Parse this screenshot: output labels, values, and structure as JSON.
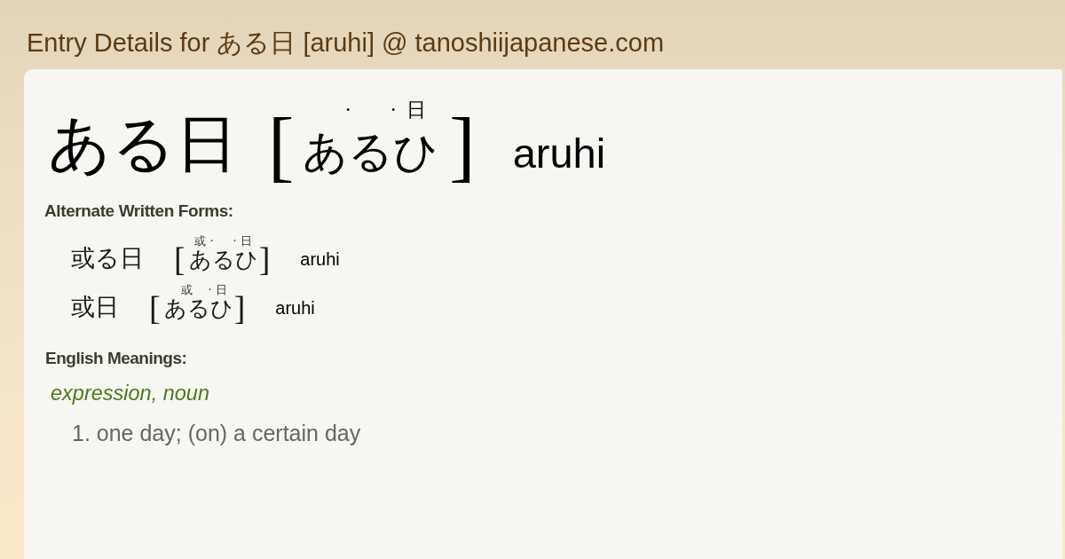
{
  "page_title": "Entry Details for ある日 [aruhi] @ tanoshiijapanese.com",
  "entry": {
    "word": "ある日",
    "reading": {
      "open": "[",
      "segments": [
        {
          "kana": "あ"
        },
        {
          "kana": "る"
        },
        {
          "kana": "ひ",
          "kanji": "日"
        }
      ],
      "separator": "·",
      "close": "]"
    },
    "romaji": "aruhi"
  },
  "alternate_forms": {
    "heading": "Alternate Written Forms:",
    "items": [
      {
        "word": "或る日",
        "reading": {
          "open": "[",
          "segments": [
            {
              "kana": "あ",
              "kanji": "或"
            },
            {
              "kana": "る"
            },
            {
              "kana": "ひ",
              "kanji": "日"
            }
          ],
          "separator": "·",
          "close": "]"
        },
        "romaji": "aruhi"
      },
      {
        "word": "或日",
        "reading": {
          "open": "[",
          "segments": [
            {
              "kana": "ある",
              "kanji": "或"
            },
            {
              "kana": "ひ",
              "kanji": "日"
            }
          ],
          "separator": "·",
          "close": "]"
        },
        "romaji": "aruhi"
      }
    ]
  },
  "meanings": {
    "heading": "English Meanings:",
    "part_of_speech": "expression, noun",
    "senses": [
      "1. one day; (on) a certain day"
    ]
  }
}
